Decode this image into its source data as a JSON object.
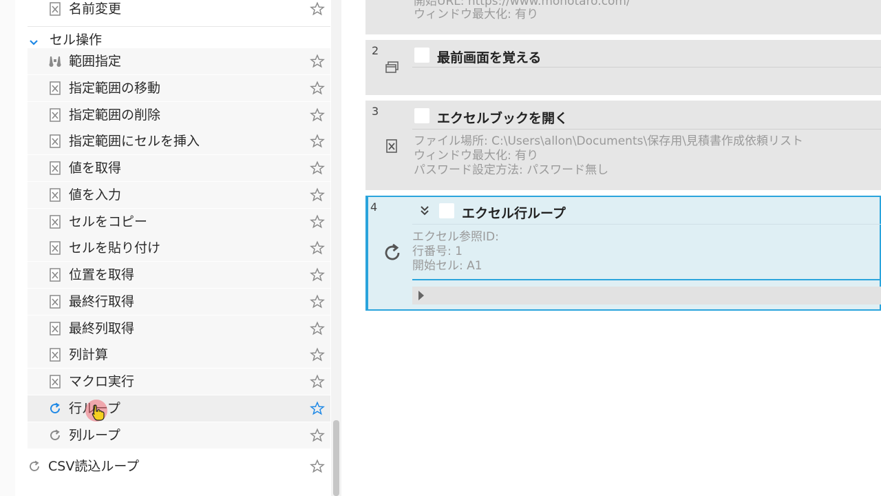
{
  "left_panel": {
    "top_item": {
      "label": "名前変更",
      "icon": "excel-file-icon"
    },
    "group": {
      "label": "セル操作",
      "expanded": true
    },
    "items": [
      {
        "label": "範囲指定",
        "icon": "binoculars-icon"
      },
      {
        "label": "指定範囲の移動",
        "icon": "excel-file-icon"
      },
      {
        "label": "指定範囲の削除",
        "icon": "excel-file-icon"
      },
      {
        "label": "指定範囲にセルを挿入",
        "icon": "excel-file-icon"
      },
      {
        "label": "値を取得",
        "icon": "excel-file-icon"
      },
      {
        "label": "値を入力",
        "icon": "excel-file-icon"
      },
      {
        "label": "セルをコピー",
        "icon": "excel-file-icon"
      },
      {
        "label": "セルを貼り付け",
        "icon": "excel-file-icon"
      },
      {
        "label": "位置を取得",
        "icon": "excel-file-icon"
      },
      {
        "label": "最終行取得",
        "icon": "excel-file-icon"
      },
      {
        "label": "最終列取得",
        "icon": "excel-file-icon"
      },
      {
        "label": "列計算",
        "icon": "excel-file-icon"
      },
      {
        "label": "マクロ実行",
        "icon": "excel-file-icon"
      },
      {
        "label": "行ループ",
        "icon": "loop-icon",
        "hover": true
      },
      {
        "label": "列ループ",
        "icon": "loop-icon"
      }
    ],
    "bottom_item": {
      "label": "CSV読込ループ",
      "icon": "loop-icon"
    }
  },
  "workspace": {
    "partial_step": {
      "lines": [
        "開始URL: https://www.monotaro.com/",
        "ウィンドウ最大化: 有り"
      ]
    },
    "steps": [
      {
        "num": "2",
        "title": "最前画面を覚える",
        "icon": "window-stack-icon",
        "details": []
      },
      {
        "num": "3",
        "title": "エクセルブックを開く",
        "icon": "excel-file-icon",
        "details": [
          "ファイル場所: C:\\Users\\allon\\Documents\\保存用\\見積書作成依頼リスト",
          "ウィンドウ最大化: 有り",
          "パスワード設定方法: パスワード無し"
        ]
      },
      {
        "num": "4",
        "title": "エクセル行ループ",
        "icon": "loop-icon",
        "details": [
          "エクセル参照ID:",
          "行番号: 1",
          "開始セル: A1"
        ]
      }
    ]
  },
  "colors": {
    "accent": "#1e88e5",
    "active_border": "#2aa4dc",
    "step_bg": "#e6e6e6",
    "active_bg": "#dfeff4"
  }
}
